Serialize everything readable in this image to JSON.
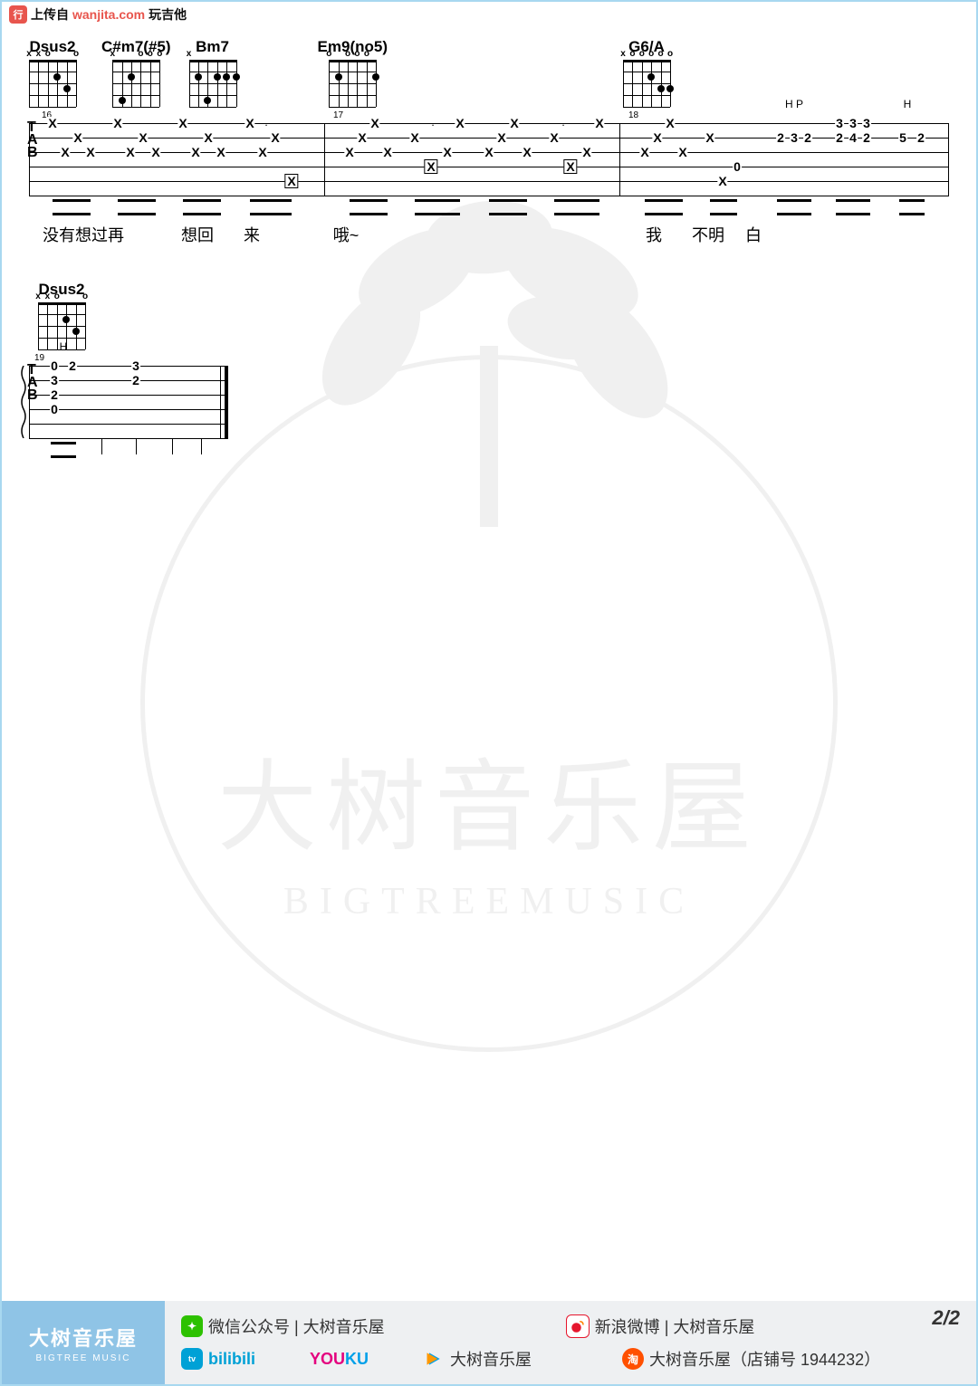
{
  "header": {
    "prefix": "上传自",
    "site": "wanjita.com",
    "suffix": "玩吉他"
  },
  "watermark": {
    "cn": "大树音乐屋",
    "en": "BIGTREEMUSIC"
  },
  "line1": {
    "bar_start": "16",
    "bar_mid": "17",
    "bar_end": "18",
    "chords": [
      "Dsus2",
      "C#m7(#5)",
      "Bm7",
      "Em9(no5)",
      "G6/A"
    ],
    "lyrics": [
      "没有想过再",
      "想回",
      "来",
      "哦~",
      "我",
      "不明",
      "白"
    ],
    "tech1": "H P",
    "tech2": "H",
    "seq_m18": [
      [
        "2",
        "3",
        "2"
      ],
      [
        "3",
        "3",
        "3"
      ],
      [
        "2",
        "4",
        "2"
      ],
      [
        "5",
        "2"
      ]
    ]
  },
  "line2": {
    "bar": "19",
    "chord": "Dsus2",
    "tech": "H",
    "col1": [
      "0",
      "3",
      "2",
      "0"
    ],
    "col2": [
      "2"
    ],
    "col4": [
      "3",
      "2"
    ]
  },
  "footer": {
    "brand_cn": "大树音乐屋",
    "brand_en": "BIGTREE MUSIC",
    "wechat": "微信公众号 | 大树音乐屋",
    "weibo": "新浪微博 | 大树音乐屋",
    "bili": "bilibili",
    "youku": "YOUKU",
    "tencent": "大树音乐屋",
    "taobao": "大树音乐屋（店铺号 1944232）",
    "page": "2/2"
  }
}
